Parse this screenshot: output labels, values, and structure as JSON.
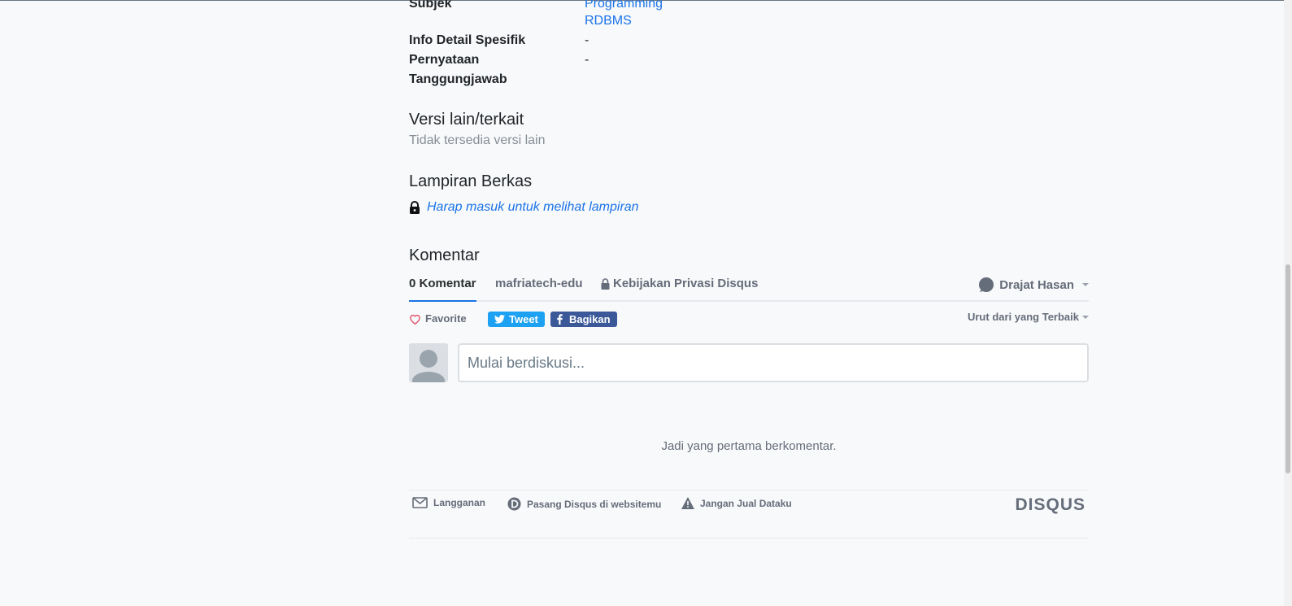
{
  "meta": {
    "subject_label": "Subjek",
    "subject_links": [
      "Programming",
      "RDBMS"
    ],
    "detail_label": "Info Detail Spesifik",
    "detail_value": "-",
    "statement_label_1": "Pernyataan",
    "statement_label_2": "Tanggungjawab",
    "statement_value": "-"
  },
  "versions": {
    "title": "Versi lain/terkait",
    "empty": "Tidak tersedia versi lain"
  },
  "attachments": {
    "title": "Lampiran Berkas",
    "login_link": "Harap masuk untuk melihat lampiran"
  },
  "comments": {
    "title": "Komentar",
    "tabs": [
      "0 Komentar",
      "mafriatech-edu",
      "Kebijakan Privasi Disqus"
    ],
    "user": "Drajat Hasan",
    "favorite": "Favorite",
    "tweet": "Tweet",
    "share": "Bagikan",
    "sort": "Urut dari yang Terbaik",
    "compose_placeholder": "Mulai berdiskusi...",
    "empty_message": "Jadi yang pertama berkomentar.",
    "footer": {
      "subscribe": "Langganan",
      "install": "Pasang Disqus di websitemu",
      "dont_sell": "Jangan Jual Dataku",
      "logo": "DISQUS"
    }
  },
  "colors": {
    "link": "#1a73e8",
    "tweet": "#1da1f2",
    "facebook": "#3b5998",
    "background": "#f8f9fa"
  }
}
